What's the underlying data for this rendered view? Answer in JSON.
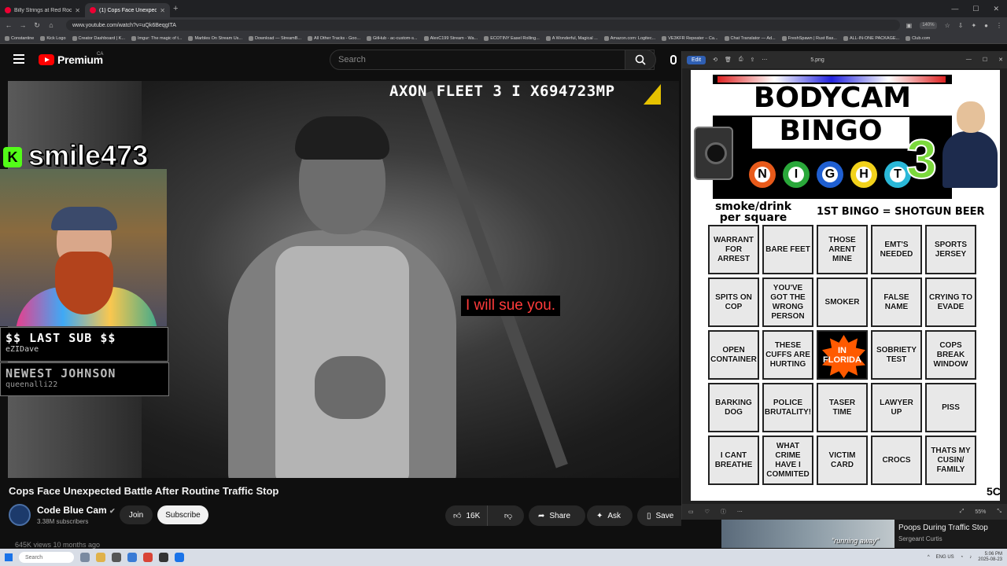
{
  "browser": {
    "tabs": [
      {
        "label": "Billy Strings at Red Rocks A",
        "active": false
      },
      {
        "label": "(1) Cops Face Unexpected B",
        "active": true
      }
    ],
    "url": "www.youtube.com/watch?v=uQk6BeqgITA",
    "zoom": "140%",
    "bookmarks": [
      "Constantine",
      "Kick Logo",
      "Creator Dashboard | K...",
      "Imgur: The magic of t...",
      "Marbles On Stream Us...",
      "Download — StreamB...",
      "All Other Tracks - Goo...",
      "GitHub - ac-custom-s...",
      "AlexC199 Stream - Wa...",
      "ECOTINY Easel Rolling...",
      "A Wonderful, Magical ...",
      "Amazon.com: Logitec...",
      "VE3KFR Repeater – Ca...",
      "Chat Translator — Ad...",
      "FreshSpawn | Rust Bas...",
      "ALL-IN-ONE PACKAGE...",
      "Club.com"
    ]
  },
  "youtube": {
    "brand": "Premium",
    "region": "CA",
    "search_placeholder": "Search"
  },
  "video": {
    "camera_stamp": "AXON FLEET 3 I X694723MP",
    "caption": "I will sue you.",
    "streamer_name": "smile473",
    "kick_letter": "K",
    "last_sub_label": "$$ LAST SUB $$",
    "last_sub_name": "eZIDave",
    "newest_label": "NEWEST JOHNSON",
    "newest_name": "queenalli22"
  },
  "meta": {
    "title": "Cops Face Unexpected Battle After Routine Traffic Stop",
    "channel": "Code Blue Cam",
    "subscribers": "3.38M subscribers",
    "join_label": "Join",
    "subscribe_label": "Subscribe",
    "likes": "16K",
    "share_label": "Share",
    "ask_label": "Ask",
    "save_label": "Save",
    "views": "645K views  10 months ago"
  },
  "viewer": {
    "edit_label": "Edit",
    "filename": "5.png",
    "zoom": "55%"
  },
  "bingo": {
    "title_line1": "BODYCAM",
    "title_line2": "BINGO",
    "number": "3",
    "balls": [
      {
        "letter": "N",
        "color": "#e85a1a"
      },
      {
        "letter": "I",
        "color": "#2aa83a"
      },
      {
        "letter": "G",
        "color": "#1f5fd1"
      },
      {
        "letter": "H",
        "color": "#f2d21b"
      },
      {
        "letter": "T",
        "color": "#2ab8d8"
      }
    ],
    "rule_left": "smoke/drink per square",
    "rule_right": "1ST BINGO = SHOTGUN BEER",
    "cells": [
      "WARRANT FOR ARREST",
      "BARE FEET",
      "THOSE ARENT MINE",
      "EMT'S NEEDED",
      "SPORTS JERSEY",
      "SPITS ON COP",
      "YOU'VE GOT THE WRONG PERSON",
      "SMOKER",
      "FALSE NAME",
      "CRYING TO EVADE",
      "OPEN CONTAINER",
      "THESE CUFFS ARE HURTING",
      "IN FLORIDA",
      "SOBRIETY TEST",
      "COPS BREAK WINDOW",
      "BARKING DOG",
      "POLICE BRUTALITY!",
      "TASER TIME",
      "LAWYER UP",
      "PISS",
      "I CANT BREATHE",
      "WHAT CRIME HAVE I COMMITED",
      "VICTIM CARD",
      "CROCS",
      "THATS MY CUSIN/ FAMILY"
    ],
    "free_index": 12,
    "corner_mark": "5C"
  },
  "upnext": {
    "title": "Poops During Traffic Stop",
    "channel": "Sergeant Curtis",
    "thumb_text": "\"running away\""
  },
  "taskbar": {
    "search_placeholder": "Search",
    "lang": "ENG US",
    "time": "5:06 PM",
    "date": "2025-08-23"
  }
}
